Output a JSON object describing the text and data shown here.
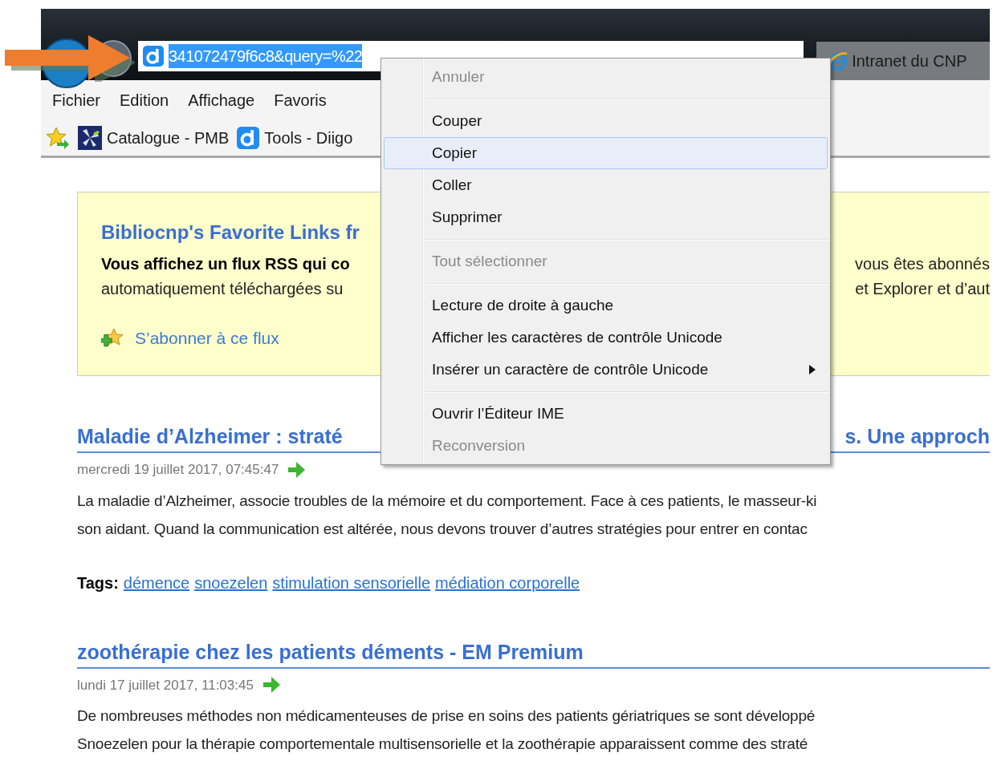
{
  "address_bar": {
    "url": "341072479f6c8&query=%22",
    "selected": true
  },
  "tab": {
    "title": "Intranet du CNP"
  },
  "menu_bar": [
    "Fichier",
    "Edition",
    "Affichage",
    "Favoris"
  ],
  "favorites_bar": [
    {
      "label": "Catalogue - PMB",
      "kind": "pinwheel"
    },
    {
      "label": "Tools - Diigo",
      "kind": "letter"
    }
  ],
  "feed_box": {
    "title": "Bibliocnp's Favorite Links fr",
    "lines_left": [
      "Vous affichez un flux RSS qui co",
      "automatiquement téléchargées su"
    ],
    "lines_right": [
      "vous êtes abonnés",
      "et Explorer et d’aut"
    ],
    "subscribe_link": "S’abonner à ce flux"
  },
  "articles": [
    {
      "title_left": "Maladie d’Alzheimer : straté",
      "title_right": "s. Une approch",
      "date": "mercredi 19 juillet 2017, 07:45:47",
      "paragraph_lines": [
        "La maladie d’Alzheimer, associe troubles de la mémoire et du comportement. Face à ces patients, le masseur-ki",
        "son aidant. Quand la communication est altérée, nous devons trouver d’autres stratégies pour entrer en contac"
      ],
      "tags_label": "Tags:",
      "tags": [
        "démence",
        "snoezelen",
        "stimulation sensorielle",
        "médiation corporelle"
      ]
    },
    {
      "title_left": "zoothérapie chez les patients déments - EM Premium",
      "date": "lundi 17 juillet 2017, 11:03:45",
      "paragraph_lines": [
        "De nombreuses méthodes non médicamenteuses de prise en soins des patients gériatriques se sont développé",
        "Snoezelen pour la thérapie comportementale multisensorielle et la zoothérapie apparaissent comme des straté"
      ]
    }
  ],
  "context_menu": {
    "items": [
      {
        "kind": "item",
        "label": "Annuler",
        "disabled": true,
        "selected": false,
        "submenu": false
      },
      {
        "kind": "separator"
      },
      {
        "kind": "item",
        "label": "Couper",
        "disabled": false,
        "selected": false,
        "submenu": false
      },
      {
        "kind": "item",
        "label": "Copier",
        "disabled": false,
        "selected": true,
        "submenu": false
      },
      {
        "kind": "item",
        "label": "Coller",
        "disabled": false,
        "selected": false,
        "submenu": false
      },
      {
        "kind": "item",
        "label": "Supprimer",
        "disabled": false,
        "selected": false,
        "submenu": false
      },
      {
        "kind": "separator"
      },
      {
        "kind": "item",
        "label": "Tout sélectionner",
        "disabled": true,
        "selected": false,
        "submenu": false
      },
      {
        "kind": "separator"
      },
      {
        "kind": "item",
        "label": "Lecture de droite à gauche",
        "disabled": false,
        "selected": false,
        "submenu": false
      },
      {
        "kind": "item",
        "label": "Afficher les caractères de contrôle Unicode",
        "disabled": false,
        "selected": false,
        "submenu": false
      },
      {
        "kind": "item",
        "label": "Insérer un caractère de contrôle Unicode",
        "disabled": false,
        "selected": false,
        "submenu": true
      },
      {
        "kind": "separator"
      },
      {
        "kind": "item",
        "label": "Ouvrir l’Éditeur IME",
        "disabled": false,
        "selected": false,
        "submenu": false
      },
      {
        "kind": "item",
        "label": "Reconversion",
        "disabled": true,
        "selected": false,
        "submenu": false
      }
    ]
  }
}
